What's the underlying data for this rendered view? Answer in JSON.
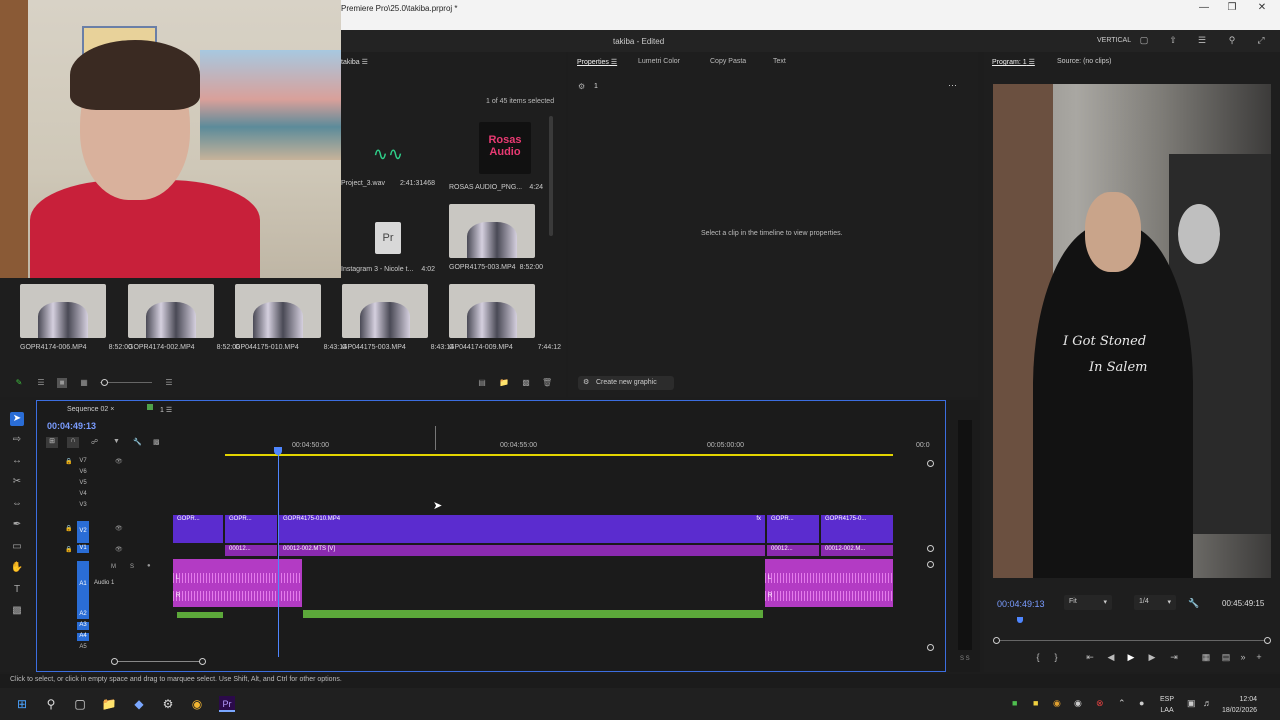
{
  "window": {
    "title": "Premiere Pro\\25.0\\takiba.prproj *",
    "controls": [
      "minimize",
      "maximize",
      "close"
    ]
  },
  "app_header": {
    "project_name": "takiba",
    "project_state": "- Edited",
    "workspace": "VERTICAL"
  },
  "project_panel": {
    "tab_label": "takiba",
    "selection_count": "1 of 45 items selected",
    "items": [
      {
        "name": "Project_3.wav",
        "duration": "2:41:31468",
        "kind": "audio"
      },
      {
        "name": "ROSAS AUDIO_PNG...",
        "duration": "4:24",
        "kind": "image",
        "logo_text": "Rosas Audio"
      },
      {
        "name": "Instagram 3 - Nicole t...",
        "duration": "4:02",
        "kind": "project",
        "icon_text": "Pr"
      },
      {
        "name": "GOPR4175-003.MP4",
        "duration": "8:52:00",
        "kind": "video"
      },
      {
        "name": "GOPR4174-006.MP4",
        "duration": "8:52:00",
        "kind": "video"
      },
      {
        "name": "GOPR4174-002.MP4",
        "duration": "8:52:00",
        "kind": "video"
      },
      {
        "name": "GP044175-010.MP4",
        "duration": "8:43:14",
        "kind": "video"
      },
      {
        "name": "GP044175-003.MP4",
        "duration": "8:43:14",
        "kind": "video"
      },
      {
        "name": "GP044174-009.MP4",
        "duration": "7:44:12",
        "kind": "video"
      }
    ]
  },
  "properties_panel": {
    "tabs": [
      "Properties",
      "Lumetri Color",
      "Copy Pasta",
      "Text"
    ],
    "selection_number": "1",
    "empty_message": "Select a clip in the timeline to view properties.",
    "create_graphic_label": "Create new graphic"
  },
  "program_monitor": {
    "tab_program": "Program: 1",
    "tab_source": "Source: (no clips)",
    "timecode": "00:04:49:13",
    "fit": "Fit",
    "resolution": "1/4",
    "duration": "00:45:49:15",
    "shirt_text_1": "I Got Stoned",
    "shirt_text_2": "In Salem"
  },
  "timeline": {
    "sequence_name": "Sequence 02",
    "sequence_tab_2": "1",
    "timecode": "00:04:49:13",
    "ruler_labels": [
      "00:04:50:00",
      "00:04:55:00",
      "00:05:00:00",
      "00:0"
    ],
    "video_tracks": [
      "V7",
      "V6",
      "V5",
      "V4",
      "V3",
      "V2",
      "V1"
    ],
    "audio_tracks": [
      "A1",
      "A2",
      "A3",
      "A4",
      "A5"
    ],
    "audio1_name": "Audio 1",
    "track_flags": [
      "M",
      "S"
    ],
    "v2_clips": [
      "GOPR...",
      "GOPR...",
      "GOPR4175-010.MP4",
      "GOPR...",
      "GOPR4175-0..."
    ],
    "v1_clips": [
      "00012...",
      "00012-002.MTS [V]",
      "00012...",
      "00012-002.M..."
    ],
    "fx": "fx",
    "channel_l": "L",
    "channel_r": "R",
    "meter_label": "S S"
  },
  "status_bar": {
    "hint": "Click to select, or click in empty space and drag to marquee select. Use Shift, Alt, and Ctrl for other options."
  },
  "taskbar": {
    "lang_1": "ESP",
    "lang_2": "LAA",
    "time": "12:04",
    "date": "18/02/2026"
  }
}
